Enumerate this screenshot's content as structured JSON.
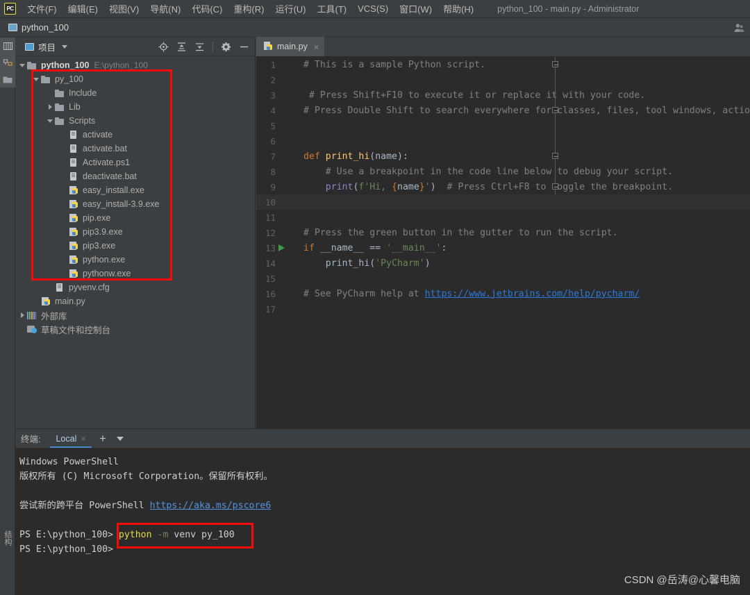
{
  "window": {
    "title": "python_100 - main.py - Administrator",
    "app_logo": "PC"
  },
  "menubar": {
    "items": [
      {
        "label": "文件(F)",
        "name": "menu-file"
      },
      {
        "label": "编辑(E)",
        "name": "menu-edit"
      },
      {
        "label": "视图(V)",
        "name": "menu-view"
      },
      {
        "label": "导航(N)",
        "name": "menu-navigate"
      },
      {
        "label": "代码(C)",
        "name": "menu-code"
      },
      {
        "label": "重构(R)",
        "name": "menu-refactor"
      },
      {
        "label": "运行(U)",
        "name": "menu-run"
      },
      {
        "label": "工具(T)",
        "name": "menu-tools"
      },
      {
        "label": "VCS(S)",
        "name": "menu-vcs"
      },
      {
        "label": "窗口(W)",
        "name": "menu-window"
      },
      {
        "label": "帮助(H)",
        "name": "menu-help"
      }
    ]
  },
  "navbar": {
    "project_name": "python_100"
  },
  "left_strip": {
    "structure_label": "结构"
  },
  "project_panel": {
    "header_label": "项目",
    "tools": [
      "locate-icon",
      "expand-all-icon",
      "collapse-all-icon",
      "settings-icon",
      "hide-icon"
    ],
    "tree": [
      {
        "label": "python_100",
        "path": "E:\\python_100",
        "icon": "folder-icon",
        "arrow": "down",
        "depth": 0,
        "bold": true
      },
      {
        "label": "py_100",
        "icon": "folder-icon",
        "arrow": "down",
        "depth": 1
      },
      {
        "label": "Include",
        "icon": "folder-icon",
        "arrow": "none",
        "depth": 2
      },
      {
        "label": "Lib",
        "icon": "folder-icon",
        "arrow": "right",
        "depth": 2
      },
      {
        "label": "Scripts",
        "icon": "folder-icon",
        "arrow": "down",
        "depth": 2
      },
      {
        "label": "activate",
        "icon": "file-icon",
        "arrow": "none",
        "depth": 3
      },
      {
        "label": "activate.bat",
        "icon": "file-icon",
        "arrow": "none",
        "depth": 3
      },
      {
        "label": "Activate.ps1",
        "icon": "file-icon",
        "arrow": "none",
        "depth": 3
      },
      {
        "label": "deactivate.bat",
        "icon": "file-icon",
        "arrow": "none",
        "depth": 3
      },
      {
        "label": "easy_install.exe",
        "icon": "python-file-icon",
        "arrow": "none",
        "depth": 3
      },
      {
        "label": "easy_install-3.9.exe",
        "icon": "python-file-icon",
        "arrow": "none",
        "depth": 3
      },
      {
        "label": "pip.exe",
        "icon": "python-file-icon",
        "arrow": "none",
        "depth": 3
      },
      {
        "label": "pip3.9.exe",
        "icon": "python-file-icon",
        "arrow": "none",
        "depth": 3
      },
      {
        "label": "pip3.exe",
        "icon": "python-file-icon",
        "arrow": "none",
        "depth": 3
      },
      {
        "label": "python.exe",
        "icon": "python-file-icon",
        "arrow": "none",
        "depth": 3
      },
      {
        "label": "pythonw.exe",
        "icon": "python-file-icon",
        "arrow": "none",
        "depth": 3
      },
      {
        "label": "pyvenv.cfg",
        "icon": "file-icon",
        "arrow": "none",
        "depth": 2
      },
      {
        "label": "main.py",
        "icon": "python-file-icon",
        "arrow": "none",
        "depth": 1
      },
      {
        "label": "外部库",
        "icon": "library-icon",
        "arrow": "right",
        "depth": 0
      },
      {
        "label": "草稿文件和控制台",
        "icon": "console-icon",
        "arrow": "none",
        "depth": 0
      }
    ]
  },
  "editor": {
    "tab": {
      "label": "main.py",
      "close": "×"
    },
    "lines": [
      {
        "num": "1",
        "segments": [
          {
            "t": "# This is a sample Python script.",
            "c": "c-comment"
          }
        ],
        "fold": "start",
        "indent": 0
      },
      {
        "num": "2",
        "segments": [],
        "indent": 0
      },
      {
        "num": "3",
        "segments": [
          {
            "t": " # Press Shift+F10 to execute it or replace it with your code.",
            "c": "c-comment"
          }
        ],
        "indent": 0
      },
      {
        "num": "4",
        "segments": [
          {
            "t": "# Press Double Shift to search everywhere for classes, files, tool windows, actio",
            "c": "c-comment"
          }
        ],
        "fold": "end",
        "indent": 0
      },
      {
        "num": "5",
        "segments": [],
        "indent": 0
      },
      {
        "num": "6",
        "segments": [],
        "indent": 0
      },
      {
        "num": "7",
        "segments": [
          {
            "t": "def ",
            "c": "c-kw"
          },
          {
            "t": "print_hi",
            "c": "c-fn"
          },
          {
            "t": "(name):",
            "c": "c-plain"
          }
        ],
        "fold": "start",
        "indent": 0
      },
      {
        "num": "8",
        "segments": [
          {
            "t": "    # Use a breakpoint in the code line below to debug your script.",
            "c": "c-comment"
          }
        ],
        "indent": 0
      },
      {
        "num": "9",
        "segments": [
          {
            "t": "    ",
            "c": "c-plain"
          },
          {
            "t": "print",
            "c": "c-builtin"
          },
          {
            "t": "(",
            "c": "c-plain"
          },
          {
            "t": "f'Hi, ",
            "c": "c-str"
          },
          {
            "t": "{",
            "c": "c-brace"
          },
          {
            "t": "name",
            "c": "c-plain"
          },
          {
            "t": "}",
            "c": "c-brace"
          },
          {
            "t": "'",
            "c": "c-str"
          },
          {
            "t": ")",
            "c": "c-plain"
          },
          {
            "t": "  # Press Ctrl+F8 to toggle the breakpoint.",
            "c": "c-comment"
          }
        ],
        "fold": "end",
        "indent": 0
      },
      {
        "num": "10",
        "segments": [],
        "current": true,
        "indent": 0
      },
      {
        "num": "11",
        "segments": [],
        "indent": 0
      },
      {
        "num": "12",
        "segments": [
          {
            "t": "# Press the green button in the gutter to run the script.",
            "c": "c-comment"
          }
        ],
        "indent": 0
      },
      {
        "num": "13",
        "segments": [
          {
            "t": "if ",
            "c": "c-kw"
          },
          {
            "t": "__name__ == ",
            "c": "c-plain"
          },
          {
            "t": "'__main__'",
            "c": "c-str"
          },
          {
            "t": ":",
            "c": "c-plain"
          }
        ],
        "run": true,
        "indent": 0
      },
      {
        "num": "14",
        "segments": [
          {
            "t": "    print_hi(",
            "c": "c-plain"
          },
          {
            "t": "'PyCharm'",
            "c": "c-str"
          },
          {
            "t": ")",
            "c": "c-plain"
          }
        ],
        "indent": 0
      },
      {
        "num": "15",
        "segments": [],
        "indent": 0
      },
      {
        "num": "16",
        "segments": [
          {
            "t": "# See PyCharm help at ",
            "c": "c-comment"
          },
          {
            "t": "https://www.jetbrains.com/help/pycharm/",
            "c": "c-link"
          }
        ],
        "indent": 0
      },
      {
        "num": "17",
        "segments": [],
        "indent": 0
      }
    ]
  },
  "terminal": {
    "label": "终端:",
    "tab_name": "Local",
    "tab_close": "×",
    "add_label": "+",
    "lines": [
      [
        {
          "t": "Windows PowerShell",
          "c": ""
        }
      ],
      [
        {
          "t": "版权所有 (C) Microsoft Corporation。保留所有权利。",
          "c": ""
        }
      ],
      [
        {
          "t": "",
          "c": ""
        }
      ],
      [
        {
          "t": "尝试新的跨平台 PowerShell ",
          "c": ""
        },
        {
          "t": "https://aka.ms/pscore6",
          "c": "t-link"
        }
      ],
      [
        {
          "t": "",
          "c": ""
        }
      ],
      [
        {
          "t": "PS E:\\python_100> ",
          "c": ""
        },
        {
          "t": "python",
          "c": "t-cmd"
        },
        {
          "t": " -m",
          "c": "t-flag"
        },
        {
          "t": " venv py_100",
          "c": "t-arg"
        }
      ],
      [
        {
          "t": "PS E:\\python_100>",
          "c": ""
        }
      ]
    ]
  },
  "watermark": {
    "text": "CSDN @岳涛@心馨电脑"
  },
  "highlight": {
    "color": "#fb0a0a"
  }
}
